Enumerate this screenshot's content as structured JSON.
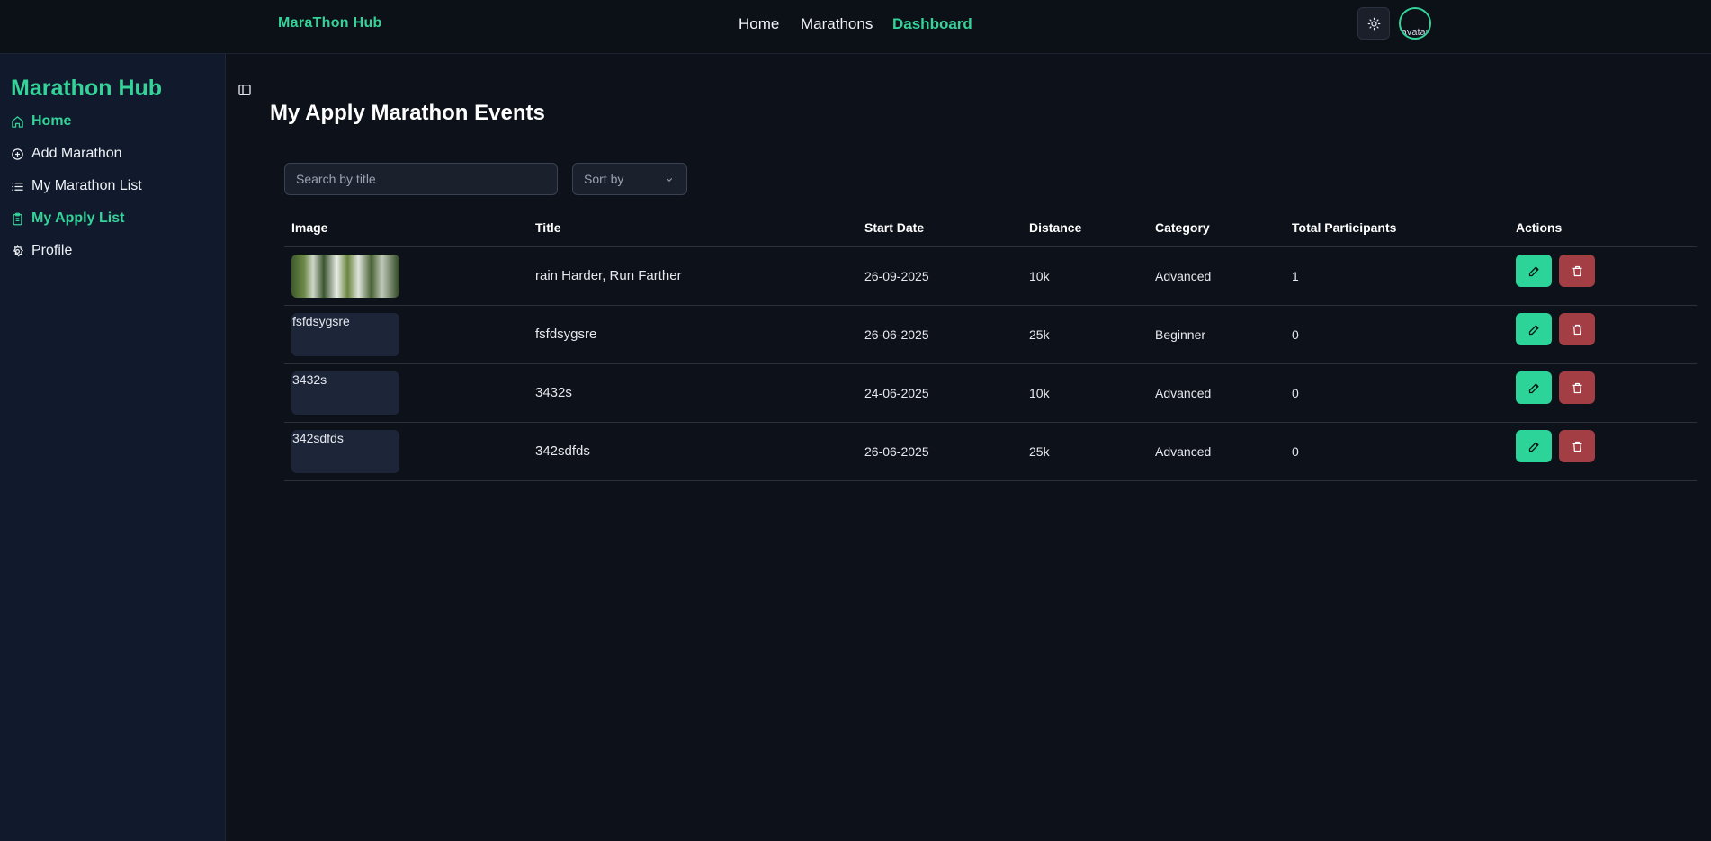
{
  "topbar": {
    "brand": "MaraThon Hub",
    "nav": [
      {
        "label": "Home",
        "active": false
      },
      {
        "label": "Marathons",
        "active": false
      },
      {
        "label": "Dashboard",
        "active": true
      }
    ],
    "theme_icon": "sun-icon",
    "avatar_alt": "avatar"
  },
  "sidebar": {
    "brand": "Marathon Hub",
    "items": [
      {
        "label": "Home",
        "icon": "home-icon",
        "active": true
      },
      {
        "label": "Add Marathon",
        "icon": "plus-circle-icon",
        "active": false
      },
      {
        "label": "My Marathon List",
        "icon": "list-icon",
        "active": false
      },
      {
        "label": "My Apply List",
        "icon": "clipboard-icon",
        "active": true
      },
      {
        "label": "Profile",
        "icon": "gear-icon",
        "active": false
      }
    ]
  },
  "main": {
    "title": "My Apply Marathon Events",
    "search": {
      "placeholder": "Search by title",
      "value": ""
    },
    "sort": {
      "label": "Sort by"
    },
    "table": {
      "columns": [
        "Image",
        "Title",
        "Start Date",
        "Distance",
        "Category",
        "Total Participants",
        "Actions"
      ],
      "rows": [
        {
          "image_alt": "",
          "has_photo": true,
          "title": "rain Harder, Run Farther",
          "start_date": "26-09-2025",
          "distance": "10k",
          "category": "Advanced",
          "participants": "1"
        },
        {
          "image_alt": "fsfdsygsre",
          "has_photo": false,
          "title": "fsfdsygsre",
          "start_date": "26-06-2025",
          "distance": "25k",
          "category": "Beginner",
          "participants": "0"
        },
        {
          "image_alt": "3432s",
          "has_photo": false,
          "title": "3432s",
          "start_date": "24-06-2025",
          "distance": "10k",
          "category": "Advanced",
          "participants": "0"
        },
        {
          "image_alt": "342sdfds",
          "has_photo": false,
          "title": "342sdfds",
          "start_date": "26-06-2025",
          "distance": "25k",
          "category": "Advanced",
          "participants": "0"
        }
      ]
    }
  },
  "colors": {
    "accent": "#34d399",
    "edit": "#2dd49a",
    "delete": "#a33e44",
    "background": "#0d111a",
    "sidebar": "#111a2c"
  }
}
